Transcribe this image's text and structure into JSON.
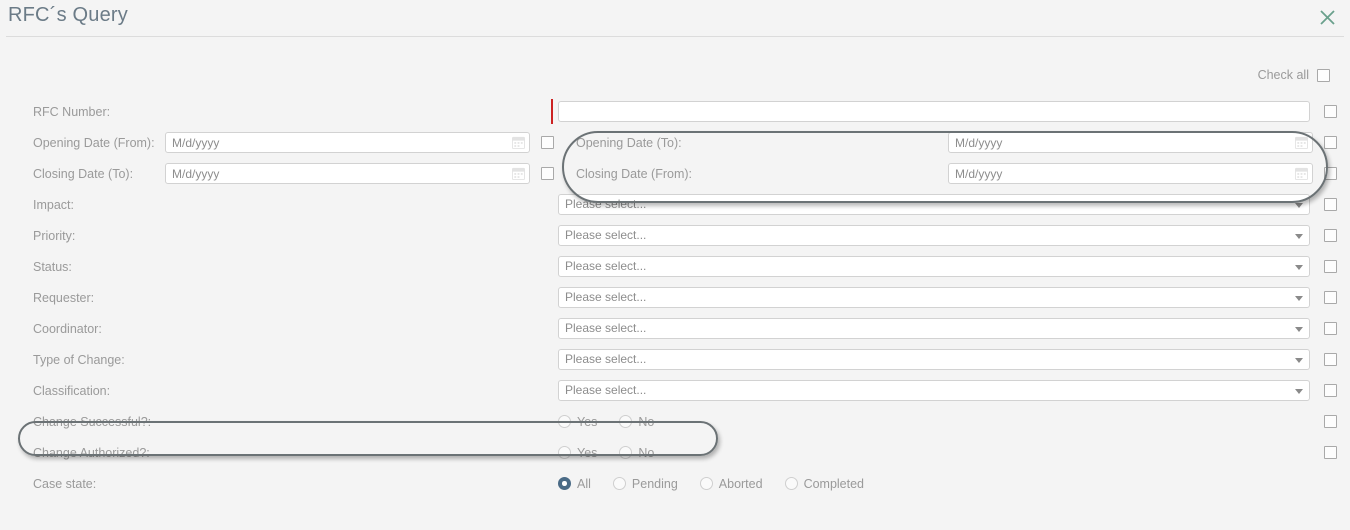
{
  "window": {
    "title": "RFC´s Query",
    "close_icon": "close-icon",
    "close_color": "#6aa08c"
  },
  "check_all": {
    "label": "Check all",
    "checked": false
  },
  "placeholders": {
    "date": "M/d/yyyy",
    "select": "Please select...",
    "text": ""
  },
  "colors": {
    "background": "#f4f4f4",
    "title": "#6b7b87",
    "label": "#9a9a9a",
    "input_border": "#d2d2d2",
    "required_marker": "#cc2222",
    "radio_selected": "#4a6b86",
    "annotation": "#6b7275"
  },
  "fields": {
    "rfc_number": {
      "label": "RFC Number:",
      "value": "",
      "required_marker": true,
      "checkbox": false
    },
    "opening_date_from": {
      "label": "Opening Date (From):",
      "value": "",
      "placeholder": "M/d/yyyy",
      "checkbox": false
    },
    "opening_date_to": {
      "label": "Opening Date (To):",
      "value": "",
      "placeholder": "M/d/yyyy",
      "checkbox": false
    },
    "closing_date_to": {
      "label": "Closing Date (To):",
      "value": "",
      "placeholder": "M/d/yyyy",
      "checkbox": false
    },
    "closing_date_from": {
      "label": "Closing Date (From):",
      "value": "",
      "placeholder": "M/d/yyyy",
      "checkbox": false
    },
    "impact": {
      "label": "Impact:",
      "value": "Please select...",
      "checkbox": false
    },
    "priority": {
      "label": "Priority:",
      "value": "Please select...",
      "checkbox": false
    },
    "status": {
      "label": "Status:",
      "value": "Please select...",
      "checkbox": false
    },
    "requester": {
      "label": "Requester:",
      "value": "Please select...",
      "checkbox": false
    },
    "coordinator": {
      "label": "Coordinator:",
      "value": "Please select...",
      "checkbox": false
    },
    "type_of_change": {
      "label": "Type of Change:",
      "value": "Please select...",
      "checkbox": false
    },
    "classification": {
      "label": "Classification:",
      "value": "Please select...",
      "checkbox": false
    },
    "change_successful": {
      "label": "Change Successful?:",
      "options": [
        "Yes",
        "No"
      ],
      "selected": null,
      "checkbox": false
    },
    "change_authorized": {
      "label": "Change Authorized?:",
      "options": [
        "Yes",
        "No"
      ],
      "selected": null,
      "checkbox": false
    },
    "case_state": {
      "label": "Case state:",
      "options": [
        "All",
        "Pending",
        "Aborted",
        "Completed"
      ],
      "selected": "All"
    }
  },
  "annotations": [
    {
      "name": "date-pair-highlight",
      "shape": "rounded-rect"
    },
    {
      "name": "change-successful-highlight",
      "shape": "rounded-rect"
    }
  ]
}
